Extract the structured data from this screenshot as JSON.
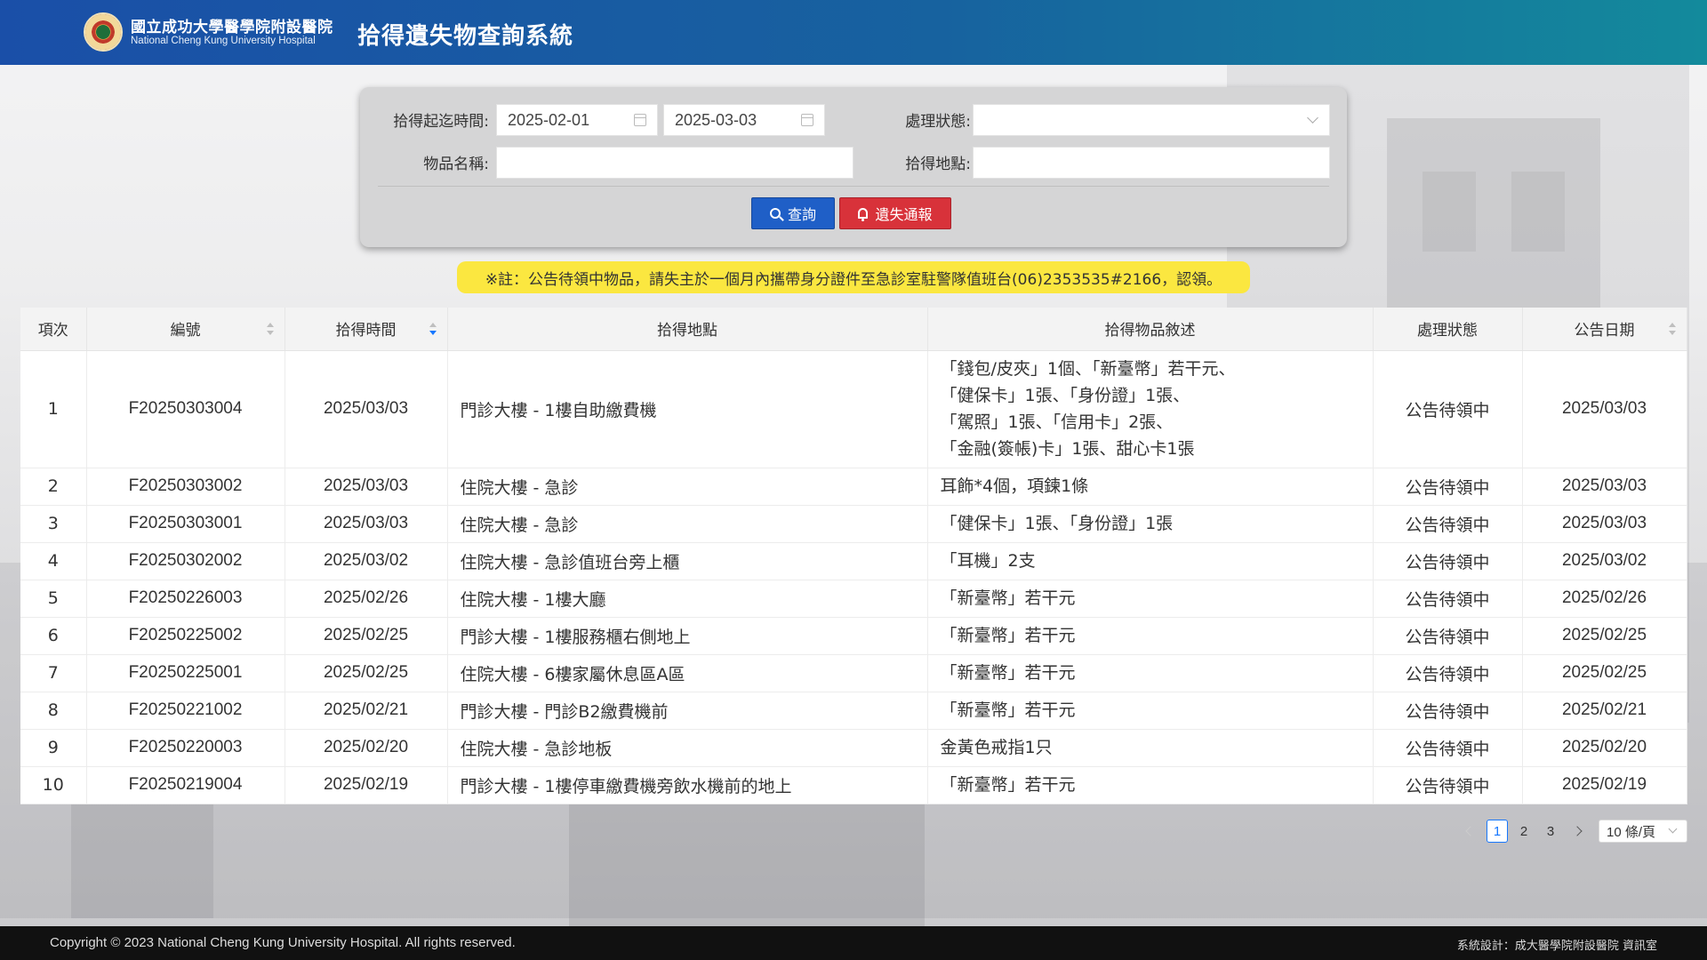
{
  "header": {
    "hospital_name_zh": "國立成功大學醫學院附設醫院",
    "hospital_name_en": "National Cheng Kung University Hospital",
    "system_title": "拾得遺失物查詢系統"
  },
  "search": {
    "date_range_label": "拾得起迄時間:",
    "start_date": "2025-02-01",
    "end_date": "2025-03-03",
    "status_label": "處理狀態:",
    "status_value": "",
    "item_name_label": "物品名稱:",
    "item_name_value": "",
    "location_label": "拾得地點:",
    "location_value": "",
    "search_button": "查詢",
    "report_button": "遺失通報"
  },
  "notice": "※註：公告待領中物品，請失主於一個月內攜帶身分證件至急診室駐警隊值班台(06)2353535#2166，認領。",
  "table": {
    "headers": [
      "項次",
      "編號",
      "拾得時間",
      "拾得地點",
      "拾得物品敘述",
      "處理狀態",
      "公告日期"
    ],
    "rows": [
      {
        "no": "1",
        "id": "F20250303004",
        "time": "2025/03/03",
        "place": "門診大樓 - 1樓自助繳費機",
        "desc": [
          "「錢包/皮夾」1個、「新臺幣」若干元、",
          "「健保卡」1張、「身份證」1張、",
          "「駕照」1張、「信用卡」2張、",
          "「金融(簽帳)卡」1張、甜心卡1張"
        ],
        "status": "公告待領中",
        "date": "2025/03/03"
      },
      {
        "no": "2",
        "id": "F20250303002",
        "time": "2025/03/03",
        "place": "住院大樓 - 急診",
        "desc": [
          "耳飾*4個，項鍊1條"
        ],
        "status": "公告待領中",
        "date": "2025/03/03"
      },
      {
        "no": "3",
        "id": "F20250303001",
        "time": "2025/03/03",
        "place": "住院大樓 - 急診",
        "desc": [
          "「健保卡」1張、「身份證」1張"
        ],
        "status": "公告待領中",
        "date": "2025/03/03"
      },
      {
        "no": "4",
        "id": "F20250302002",
        "time": "2025/03/02",
        "place": "住院大樓 - 急診值班台旁上櫃",
        "desc": [
          "「耳機」2支"
        ],
        "status": "公告待領中",
        "date": "2025/03/02"
      },
      {
        "no": "5",
        "id": "F20250226003",
        "time": "2025/02/26",
        "place": "住院大樓 - 1樓大廳",
        "desc": [
          "「新臺幣」若干元"
        ],
        "status": "公告待領中",
        "date": "2025/02/26"
      },
      {
        "no": "6",
        "id": "F20250225002",
        "time": "2025/02/25",
        "place": "門診大樓 - 1樓服務櫃右側地上",
        "desc": [
          "「新臺幣」若干元"
        ],
        "status": "公告待領中",
        "date": "2025/02/25"
      },
      {
        "no": "7",
        "id": "F20250225001",
        "time": "2025/02/25",
        "place": "住院大樓 - 6樓家屬休息區A區",
        "desc": [
          "「新臺幣」若干元"
        ],
        "status": "公告待領中",
        "date": "2025/02/25"
      },
      {
        "no": "8",
        "id": "F20250221002",
        "time": "2025/02/21",
        "place": "門診大樓 - 門診B2繳費機前",
        "desc": [
          "「新臺幣」若干元"
        ],
        "status": "公告待領中",
        "date": "2025/02/21"
      },
      {
        "no": "9",
        "id": "F20250220003",
        "time": "2025/02/20",
        "place": "住院大樓 - 急診地板",
        "desc": [
          "金黃色戒指1只"
        ],
        "status": "公告待領中",
        "date": "2025/02/20"
      },
      {
        "no": "10",
        "id": "F20250219004",
        "time": "2025/02/19",
        "place": "門診大樓 - 1樓停車繳費機旁飲水機前的地上",
        "desc": [
          "「新臺幣」若干元"
        ],
        "status": "公告待領中",
        "date": "2025/02/19"
      }
    ]
  },
  "pagination": {
    "pages": [
      "1",
      "2",
      "3"
    ],
    "current": "1",
    "page_size": "10 條/頁"
  },
  "footer": {
    "copyright": "Copyright © 2023 National Cheng Kung University Hospital. All rights reserved.",
    "designer": "系統設計：成大醫學院附設醫院 資訊室"
  }
}
